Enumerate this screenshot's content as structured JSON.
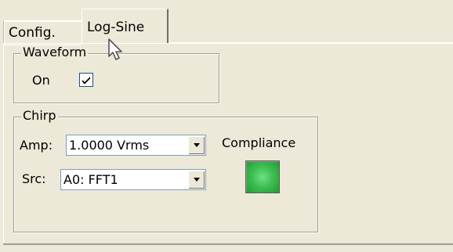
{
  "tabs": {
    "config_label": "Config.",
    "logsine_label": "Log-Sine"
  },
  "waveform": {
    "legend": "Waveform",
    "on_label": "On",
    "on_checked": true
  },
  "chirp": {
    "legend": "Chirp",
    "amp_label": "Amp:",
    "amp_value": "1.0000 Vrms",
    "src_label": "Src:",
    "src_value": "A0: FFT1",
    "compliance_label": "Compliance",
    "compliance_color": "#3fbf52"
  },
  "icons": {
    "dropdown": "chevron-down-icon",
    "checkmark": "checkmark-icon",
    "cursor": "mouse-pointer-icon"
  }
}
